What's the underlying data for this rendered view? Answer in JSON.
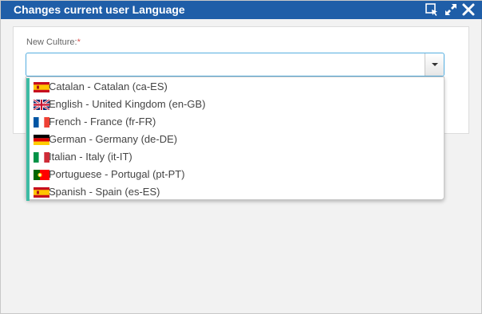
{
  "window": {
    "title": "Changes current user Language",
    "icons": [
      "select-window-icon",
      "maximize-icon",
      "close-icon"
    ]
  },
  "form": {
    "label": "New Culture:",
    "required_marker": "*",
    "input_value": ""
  },
  "accent_colors": {
    "titlebar": "#1f5ea8",
    "option_bar": "#3dbca4",
    "input_focus_border": "#55aee0"
  },
  "dropdown": {
    "options": [
      {
        "label": "Catalan - Catalan (ca-ES)",
        "flag": "spain-flag-icon"
      },
      {
        "label": "English - United Kingdom (en-GB)",
        "flag": "uk-flag-icon"
      },
      {
        "label": "French - France (fr-FR)",
        "flag": "france-flag-icon"
      },
      {
        "label": "German - Germany (de-DE)",
        "flag": "germany-flag-icon"
      },
      {
        "label": "Italian - Italy (it-IT)",
        "flag": "italy-flag-icon"
      },
      {
        "label": "Portuguese - Portugal (pt-PT)",
        "flag": "portugal-flag-icon"
      },
      {
        "label": "Spanish - Spain (es-ES)",
        "flag": "spain-flag-icon"
      }
    ]
  }
}
